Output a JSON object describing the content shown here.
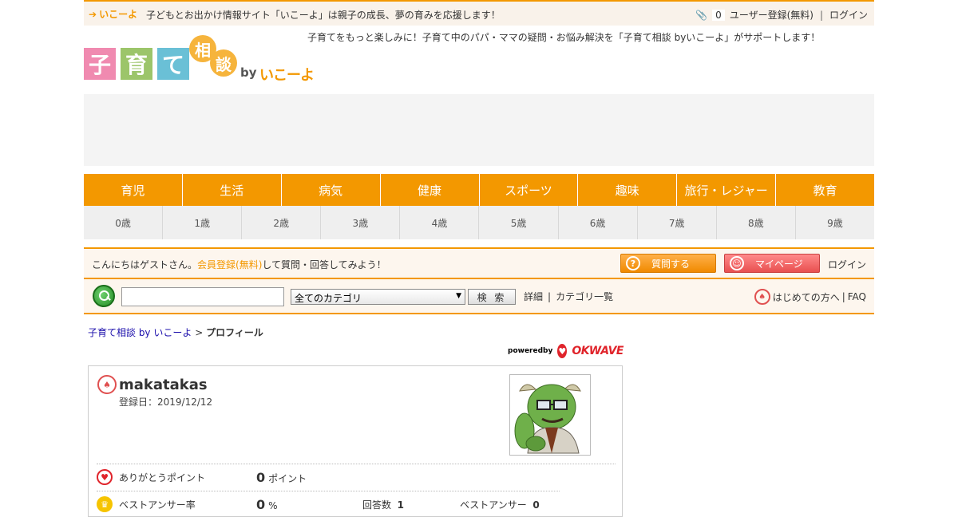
{
  "topbar": {
    "back_label": "いこーよ",
    "tagline": "子どもとお出かけ情報サイト「いこーよ」は親子の成長、夢の育みを応援します！",
    "clip_count": "0",
    "register": "ユーザー登録(無料)",
    "separator": "|",
    "login": "ログイン"
  },
  "header": {
    "logo": {
      "c1": "子",
      "c2": "育",
      "c3": "て",
      "c4": "相",
      "c5": "談",
      "by": "by",
      "brand": "いこーよ"
    },
    "message": "子育てをもっと楽しみに！子育て中のパパ・ママの疑問・お悩み解決を「子育て相談 byいこーよ」がサポートします！"
  },
  "categories": [
    "育児",
    "生活",
    "病気",
    "健康",
    "スポーツ",
    "趣味",
    "旅行・レジャー",
    "教育"
  ],
  "ages": [
    "0歳",
    "1歳",
    "2歳",
    "3歳",
    "4歳",
    "5歳",
    "6歳",
    "7歳",
    "8歳",
    "9歳"
  ],
  "greeting": {
    "pre": "こんにちはゲストさん。",
    "register_link": "会員登録(無料)",
    "post": "して質問・回答してみよう！",
    "ask_button": "質問する",
    "mypage_button": "マイページ",
    "login": "ログイン"
  },
  "search": {
    "input_value": "",
    "category_selected": "全てのカテゴリ",
    "button": "検 索",
    "detail_link": "詳細",
    "pipe": "|",
    "category_list_link": "カテゴリ一覧",
    "beginners_link": "はじめての方へ",
    "faq_pipe": "|",
    "faq_link": "FAQ"
  },
  "breadcrumb": {
    "home": "子育て相談 by いこーよ",
    "sep": ">",
    "current": "プロフィール"
  },
  "powered": {
    "label": "poweredby",
    "brand": "OKWAVE"
  },
  "profile": {
    "username": "makatakas",
    "registered": "登録日：2019/12/12",
    "thanks_label": "ありがとうポイント",
    "thanks_value": "0",
    "thanks_unit": "ポイント",
    "best_label": "ベストアンサー率",
    "best_value": "0",
    "best_unit": "%",
    "answers_label": "回答数",
    "answers_value": "1",
    "best_count_label": "ベストアンサー",
    "best_count_value": "0"
  },
  "colors": {
    "accent": "#f39800",
    "ask": "#f08a00",
    "mypage": "#e85050",
    "okwave": "#e0242b"
  }
}
